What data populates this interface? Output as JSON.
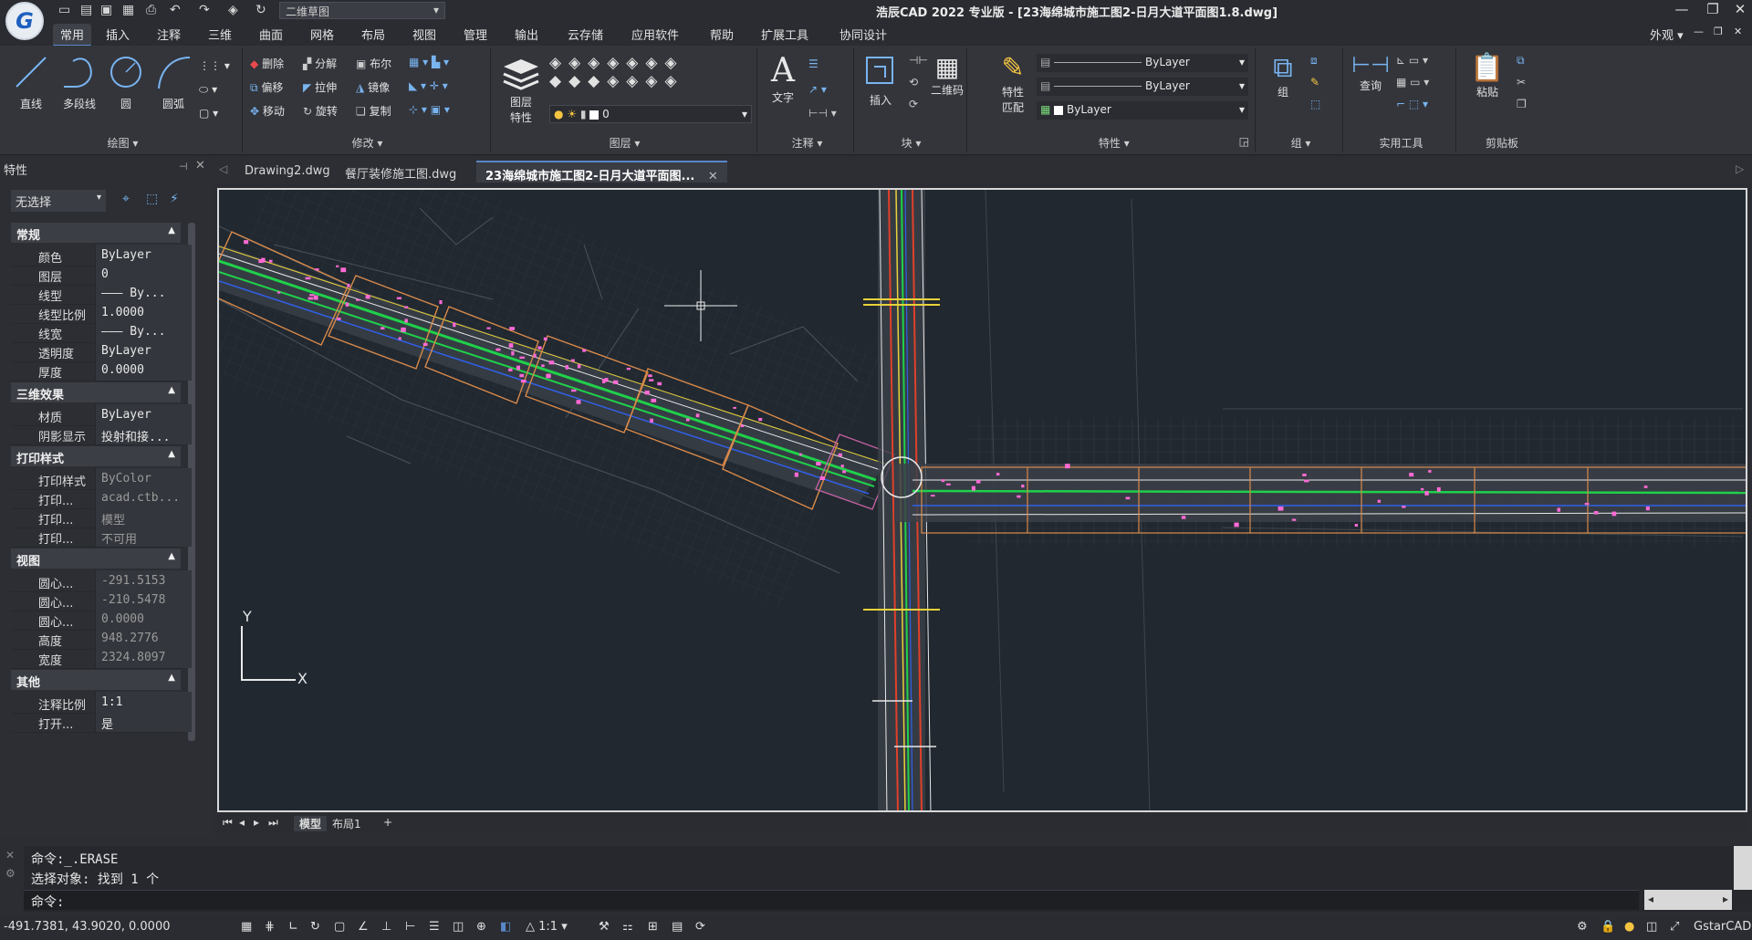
{
  "app": {
    "title": "浩辰CAD 2022 专业版 - [23海绵城市施工图2-日月大道平面图1.8.dwg]",
    "logo_letter": "G",
    "workspace": "二维草图",
    "brand": "GstarCAD"
  },
  "window_controls": {
    "minimize": "—",
    "restore": "❐",
    "close": "✕"
  },
  "menu": {
    "items": [
      "常用",
      "插入",
      "注释",
      "三维",
      "曲面",
      "网格",
      "布局",
      "视图",
      "管理",
      "输出",
      "云存储",
      "应用软件",
      "帮助",
      "扩展工具",
      "协同设计"
    ],
    "active": "常用",
    "appearance": "外观"
  },
  "ribbon": {
    "draw": {
      "title": "绘图",
      "line": "直线",
      "polyline": "多段线",
      "circle": "圆",
      "arc": "圆弧"
    },
    "modify": {
      "title": "修改",
      "items": [
        "删除",
        "分解",
        "布尔",
        "偏移",
        "拉伸",
        "镜像",
        "移动",
        "旋转",
        "复制"
      ]
    },
    "layer": {
      "title": "图层",
      "props": "图层\n特性",
      "props_l1": "图层",
      "props_l2": "特性",
      "current": "0"
    },
    "annotation": {
      "title": "注释",
      "text": "文字"
    },
    "block": {
      "title": "块",
      "insert": "插入",
      "qrcode": "二维码"
    },
    "properties": {
      "title": "特性",
      "match_l1": "特性",
      "match_l2": "匹配",
      "color": "ByLayer",
      "linetype": "ByLayer",
      "lineweight": "ByLayer"
    },
    "group": {
      "title": "组",
      "label": "组"
    },
    "utilities": {
      "title": "实用工具",
      "query": "查询"
    },
    "clipboard": {
      "title": "剪贴板",
      "paste": "粘贴"
    }
  },
  "properties_panel": {
    "title": "特性",
    "selection": "无选择",
    "sections": {
      "general": "常规",
      "3d": "三维效果",
      "print": "打印样式",
      "view": "视图",
      "misc": "其他"
    },
    "general": [
      {
        "k": "颜色",
        "v": "ByLayer"
      },
      {
        "k": "图层",
        "v": "0"
      },
      {
        "k": "线型",
        "v": "——— By..."
      },
      {
        "k": "线型比例",
        "v": "1.0000"
      },
      {
        "k": "线宽",
        "v": "——— By..."
      },
      {
        "k": "透明度",
        "v": "ByLayer"
      },
      {
        "k": "厚度",
        "v": "0.0000"
      }
    ],
    "3d": [
      {
        "k": "材质",
        "v": "ByLayer"
      },
      {
        "k": "阴影显示",
        "v": "投射和接..."
      }
    ],
    "print": [
      {
        "k": "打印样式",
        "v": "ByColor"
      },
      {
        "k": "打印...",
        "v": "acad.ctb..."
      },
      {
        "k": "打印...",
        "v": "模型"
      },
      {
        "k": "打印...",
        "v": "不可用"
      }
    ],
    "view": [
      {
        "k": "圆心...",
        "v": "-291.5153"
      },
      {
        "k": "圆心...",
        "v": "-210.5478"
      },
      {
        "k": "圆心...",
        "v": "0.0000"
      },
      {
        "k": "高度",
        "v": "948.2776"
      },
      {
        "k": "宽度",
        "v": "2324.8097"
      }
    ],
    "misc": [
      {
        "k": "注释比例",
        "v": "1:1"
      },
      {
        "k": "打开...",
        "v": "是"
      }
    ]
  },
  "doc_tabs": [
    "Drawing2.dwg",
    "餐厅装修施工图.dwg",
    "23海绵城市施工图2-日月大道平面图..."
  ],
  "active_doc_tab": 2,
  "layout_tabs": [
    "模型",
    "布局1",
    "+"
  ],
  "ucs": {
    "x": "X",
    "y": "Y"
  },
  "command": {
    "history": [
      "命令:_.ERASE",
      "选择对象: 找到 1 个"
    ],
    "prompt": "命令:"
  },
  "status": {
    "coords": "-491.7381, 43.9020, 0.0000",
    "scale": "1:1"
  },
  "colors": {
    "canvas": "#212830",
    "road_green": "#1fd14a",
    "road_red": "#e0402a",
    "road_yellow": "#e8d23a",
    "sheet_border": "#d98a4a",
    "marker": "#ff6ad5",
    "accent": "#5a87c8"
  }
}
